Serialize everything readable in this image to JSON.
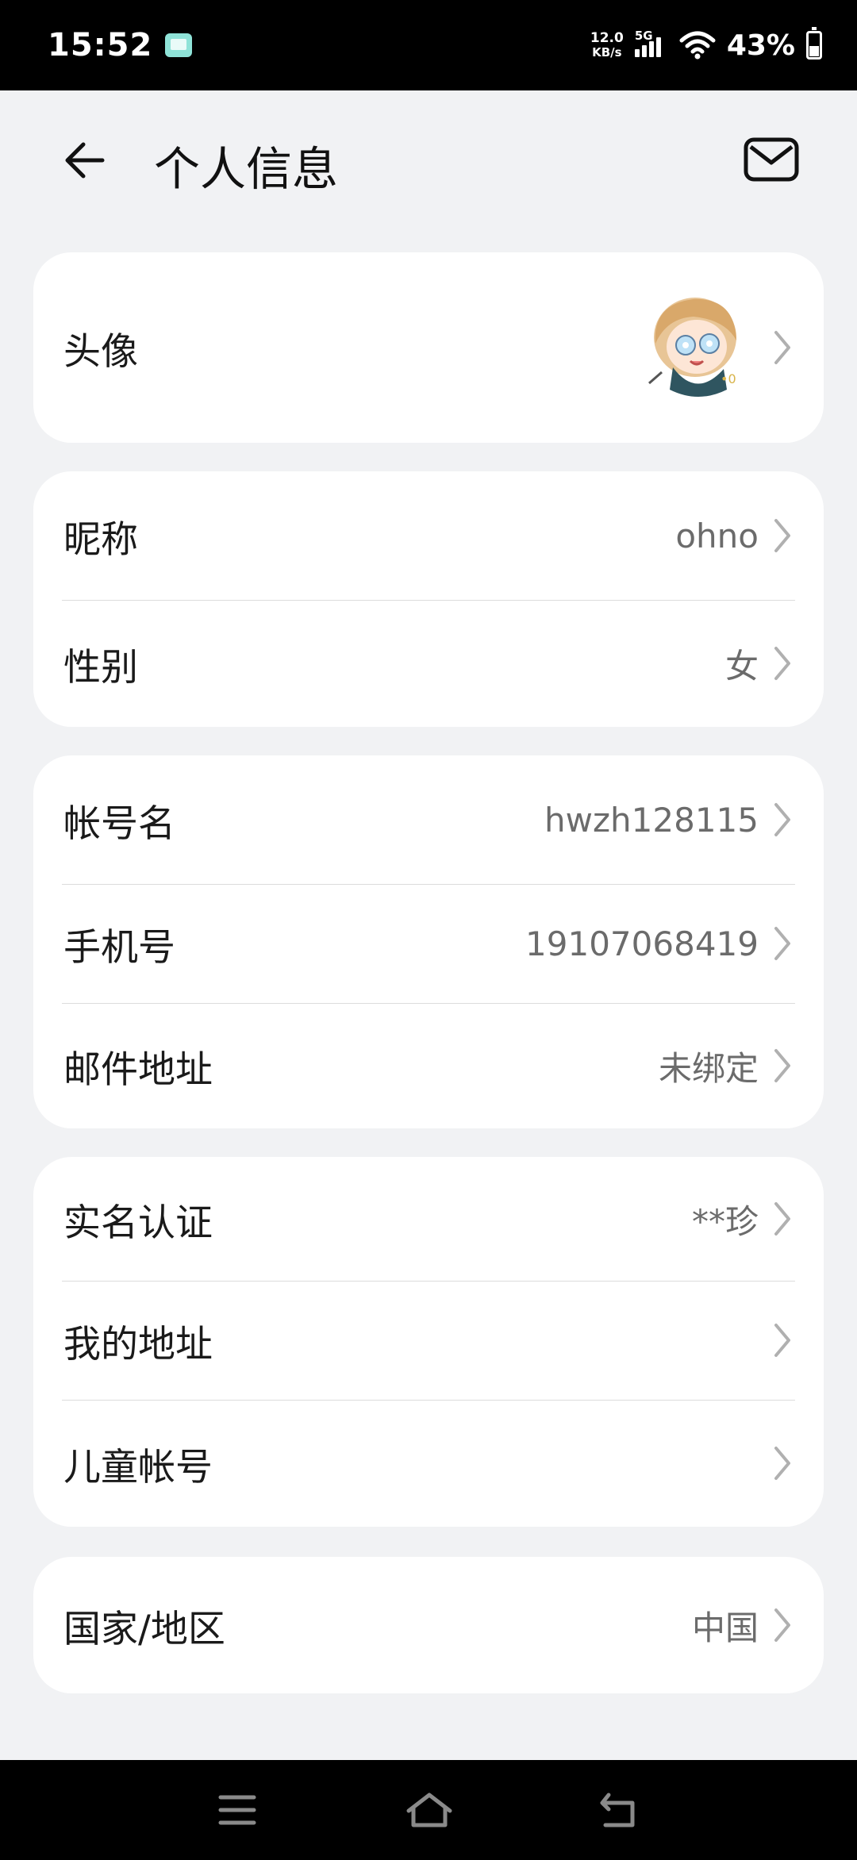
{
  "status_bar": {
    "time": "15:52",
    "net_speed_value": "12.0",
    "net_speed_unit": "KB/s",
    "network": "5G",
    "battery": "43%",
    "battery_level": 0.43
  },
  "header": {
    "title": "个人信息",
    "back_icon": "arrow-left-icon",
    "mail_icon": "mail-icon"
  },
  "cards": {
    "avatar": {
      "label": "头像"
    },
    "profile": {
      "nickname_label": "昵称",
      "nickname_value": "ohno",
      "gender_label": "性别",
      "gender_value": "女"
    },
    "account": {
      "account_label": "帐号名",
      "account_value": "hwzh128115",
      "phone_label": "手机号",
      "phone_value": "19107068419",
      "email_label": "邮件地址",
      "email_value": "未绑定"
    },
    "identity": {
      "realname_label": "实名认证",
      "realname_value": "**珍",
      "address_label": "我的地址",
      "child_label": "儿童帐号"
    },
    "region": {
      "region_label": "国家/地区",
      "region_value": "中国"
    }
  },
  "nav_bar": {
    "menu_icon": "menu-icon",
    "home_icon": "home-icon",
    "back_icon": "back-icon"
  },
  "colors": {
    "background": "#f1f2f4",
    "card": "#ffffff",
    "value_text": "#6b6b6b",
    "chevron": "#b0b0b0"
  }
}
